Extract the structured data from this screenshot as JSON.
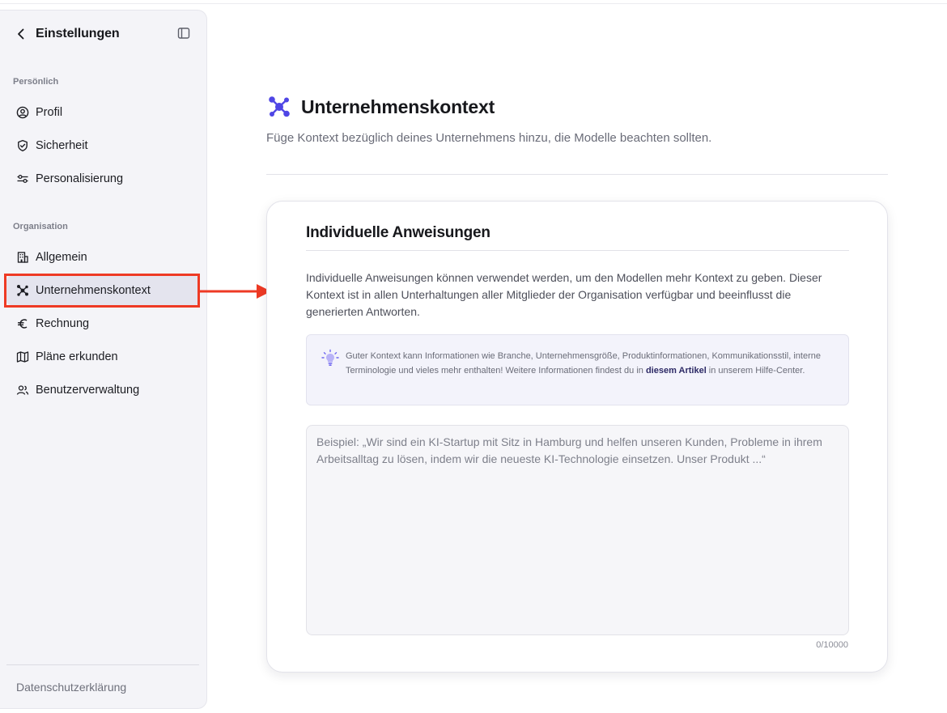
{
  "sidebar": {
    "title": "Einstellungen",
    "sections": [
      {
        "label": "Persönlich",
        "items": [
          {
            "label": "Profil",
            "icon": "user-circle-icon"
          },
          {
            "label": "Sicherheit",
            "icon": "shield-icon"
          },
          {
            "label": "Personalisierung",
            "icon": "sliders-icon"
          }
        ]
      },
      {
        "label": "Organisation",
        "items": [
          {
            "label": "Allgemein",
            "icon": "building-icon"
          },
          {
            "label": "Unternehmenskontext",
            "icon": "network-icon",
            "active": true
          },
          {
            "label": "Rechnung",
            "icon": "euro-icon"
          },
          {
            "label": "Pläne erkunden",
            "icon": "map-icon"
          },
          {
            "label": "Benutzerverwaltung",
            "icon": "users-icon"
          }
        ]
      }
    ],
    "footer": "Datenschutzerklärung"
  },
  "page": {
    "title": "Unternehmenskontext",
    "subtitle": "Füge Kontext bezüglich deines Unternehmens hinzu, die Modelle beachten sollten.",
    "icon": "network-icon"
  },
  "card": {
    "title": "Individuelle Anweisungen",
    "description": "Individuelle Anweisungen können verwendet werden, um den Modellen mehr Kontext zu geben. Dieser Kontext ist in allen Unterhaltungen aller Mitglieder der Organisation verfügbar und beeinflusst die generierten Antworten.",
    "tip": {
      "icon": "lightbulb-icon",
      "text_before": "Guter Kontext kann Informationen wie Branche, Unternehmensgröße, Produktinformationen, Kommunikationsstil, interne Terminologie und vieles mehr enthalten! Weitere Informationen findest du in ",
      "link": "diesem Artikel",
      "text_after": " in unserem Hilfe-Center."
    },
    "textarea": {
      "value": "",
      "placeholder": "Beispiel: „Wir sind ein KI-Startup mit Sitz in Hamburg und helfen unseren Kunden, Probleme in ihrem Arbeitsalltag zu lösen, indem wir die neueste KI-Technologie einsetzen. Unser Produkt ...“"
    },
    "counter": "0/10000"
  },
  "colors": {
    "accent": "#4f46e5",
    "highlight": "#ee3a24",
    "sidebar_bg": "#f4f4f8"
  }
}
